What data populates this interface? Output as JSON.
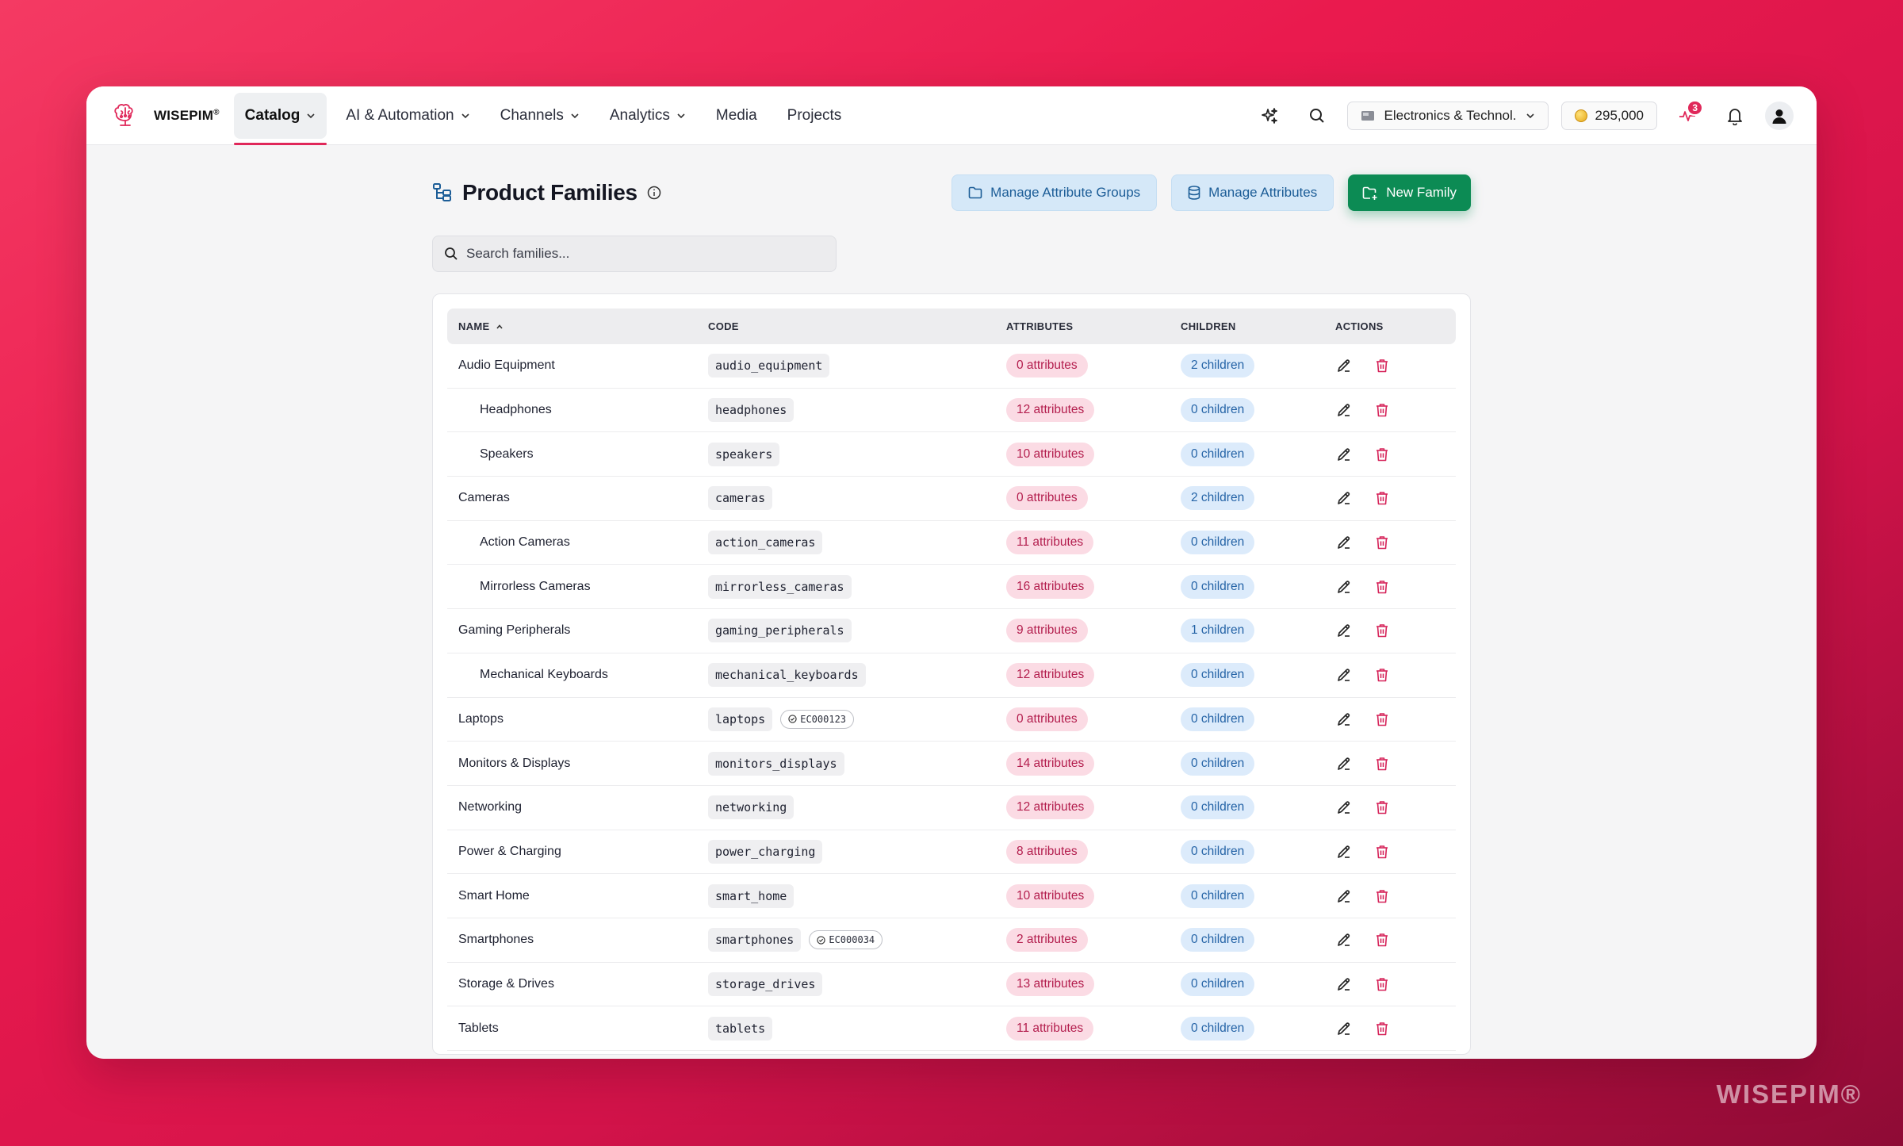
{
  "brand": {
    "name": "WISEPIM",
    "mark": "®"
  },
  "nav": {
    "items": [
      {
        "label": "Catalog",
        "dropdown": true,
        "active": true
      },
      {
        "label": "AI & Automation",
        "dropdown": true,
        "active": false
      },
      {
        "label": "Channels",
        "dropdown": true,
        "active": false
      },
      {
        "label": "Analytics",
        "dropdown": true,
        "active": false
      },
      {
        "label": "Media",
        "dropdown": false,
        "active": false
      },
      {
        "label": "Projects",
        "dropdown": false,
        "active": false
      }
    ],
    "workspace": "Electronics & Technol...",
    "credits": "295,000",
    "activity_count": "3"
  },
  "page": {
    "title": "Product Families",
    "buttons": {
      "manage_groups": "Manage Attribute Groups",
      "manage_attributes": "Manage Attributes",
      "new_family": "New Family"
    },
    "search_placeholder": "Search families..."
  },
  "table": {
    "headers": {
      "name": "NAME",
      "code": "CODE",
      "attributes": "ATTRIBUTES",
      "children": "CHILDREN",
      "actions": "ACTIONS"
    },
    "rows": [
      {
        "name": "Audio Equipment",
        "code": "audio_equipment",
        "ec": "",
        "attributes": "0 attributes",
        "children": "2 children",
        "child": false
      },
      {
        "name": "Headphones",
        "code": "headphones",
        "ec": "",
        "attributes": "12 attributes",
        "children": "0 children",
        "child": true
      },
      {
        "name": "Speakers",
        "code": "speakers",
        "ec": "",
        "attributes": "10 attributes",
        "children": "0 children",
        "child": true
      },
      {
        "name": "Cameras",
        "code": "cameras",
        "ec": "",
        "attributes": "0 attributes",
        "children": "2 children",
        "child": false
      },
      {
        "name": "Action Cameras",
        "code": "action_cameras",
        "ec": "",
        "attributes": "11 attributes",
        "children": "0 children",
        "child": true
      },
      {
        "name": "Mirrorless Cameras",
        "code": "mirrorless_cameras",
        "ec": "",
        "attributes": "16 attributes",
        "children": "0 children",
        "child": true
      },
      {
        "name": "Gaming Peripherals",
        "code": "gaming_peripherals",
        "ec": "",
        "attributes": "9 attributes",
        "children": "1 children",
        "child": false
      },
      {
        "name": "Mechanical Keyboards",
        "code": "mechanical_keyboards",
        "ec": "",
        "attributes": "12 attributes",
        "children": "0 children",
        "child": true
      },
      {
        "name": "Laptops",
        "code": "laptops",
        "ec": "EC000123",
        "attributes": "0 attributes",
        "children": "0 children",
        "child": false
      },
      {
        "name": "Monitors & Displays",
        "code": "monitors_displays",
        "ec": "",
        "attributes": "14 attributes",
        "children": "0 children",
        "child": false
      },
      {
        "name": "Networking",
        "code": "networking",
        "ec": "",
        "attributes": "12 attributes",
        "children": "0 children",
        "child": false
      },
      {
        "name": "Power & Charging",
        "code": "power_charging",
        "ec": "",
        "attributes": "8 attributes",
        "children": "0 children",
        "child": false
      },
      {
        "name": "Smart Home",
        "code": "smart_home",
        "ec": "",
        "attributes": "10 attributes",
        "children": "0 children",
        "child": false
      },
      {
        "name": "Smartphones",
        "code": "smartphones",
        "ec": "EC000034",
        "attributes": "2 attributes",
        "children": "0 children",
        "child": false
      },
      {
        "name": "Storage & Drives",
        "code": "storage_drives",
        "ec": "",
        "attributes": "13 attributes",
        "children": "0 children",
        "child": false
      },
      {
        "name": "Tablets",
        "code": "tablets",
        "ec": "",
        "attributes": "11 attributes",
        "children": "0 children",
        "child": false
      }
    ]
  },
  "watermark": "WISEPIM®",
  "colors": {
    "accent": "#e0285a",
    "primary_green": "#0c8b54",
    "soft_blue": "#d5e8f8",
    "attr_pill": "#fbdbe4",
    "child_pill": "#dcebfb"
  },
  "icons": {
    "logo": "brain-logo-icon",
    "sparkle": "sparkle-icon",
    "search": "search-icon",
    "workspace": "folder-flag-icon",
    "activity": "activity-icon",
    "bell": "bell-icon",
    "user": "user-icon",
    "family": "family-tree-icon",
    "info": "info-icon",
    "folder": "folder-icon",
    "database": "database-icon",
    "new_folder": "folder-plus-icon",
    "edit": "pencil-icon",
    "delete": "trash-icon"
  }
}
